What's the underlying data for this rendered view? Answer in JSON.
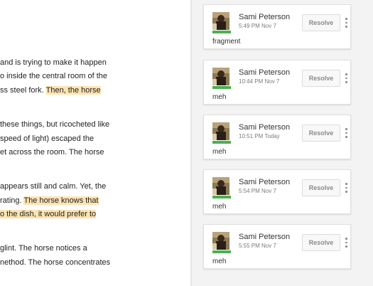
{
  "document": {
    "lines": [
      {
        "segments": [
          {
            "text": "and is trying to make it happen",
            "hl": false
          }
        ]
      },
      {
        "segments": [
          {
            "text": "o inside the central room of the",
            "hl": false
          }
        ]
      },
      {
        "segments": [
          {
            "text": "ss steel fork. ",
            "hl": false
          },
          {
            "text": "Then, the horse",
            "hl": true
          }
        ]
      },
      {
        "segments": [
          {
            "text": "these things, but ricocheted like",
            "hl": false
          }
        ]
      },
      {
        "segments": [
          {
            "text": "speed of light) escaped the",
            "hl": false
          }
        ]
      },
      {
        "segments": [
          {
            "text": "et across the room. The horse",
            "hl": false
          }
        ]
      },
      {
        "segments": [
          {
            "text": "appears still and calm. Yet, the",
            "hl": false
          }
        ]
      },
      {
        "segments": [
          {
            "text": "rating. ",
            "hl": false
          },
          {
            "text": "The horse knows that",
            "hl": true
          }
        ]
      },
      {
        "segments": [
          {
            "text": "o the dish, it would prefer to",
            "hl": true
          }
        ]
      },
      {
        "segments": [
          {
            "text": "glint. The horse notices a",
            "hl": false
          }
        ]
      },
      {
        "segments": [
          {
            "text": "nethod. The horse concentrates",
            "hl": false
          }
        ]
      }
    ]
  },
  "comments": [
    {
      "author": "Sami Peterson",
      "time": "5:49 PM Nov 7",
      "resolve_label": "Resolve",
      "text": "fragment"
    },
    {
      "author": "Sami Peterson",
      "time": "10:44 PM Nov 7",
      "resolve_label": "Resolve",
      "text": "meh"
    },
    {
      "author": "Sami Peterson",
      "time": "10:51 PM Today",
      "resolve_label": "Resolve",
      "text": "meh"
    },
    {
      "author": "Sami Peterson",
      "time": "5:54 PM Nov 7",
      "resolve_label": "Resolve",
      "text": "meh"
    },
    {
      "author": "Sami Peterson",
      "time": "5:55 PM Nov 7",
      "resolve_label": "Resolve",
      "text": "meh"
    }
  ],
  "colors": {
    "highlight": "#fde3b0",
    "avatar_bar": "#4caf50",
    "sidebar_bg": "#f3f3f3"
  },
  "icons": {
    "more": "more-vert-icon",
    "avatar": "user-avatar-photo"
  }
}
